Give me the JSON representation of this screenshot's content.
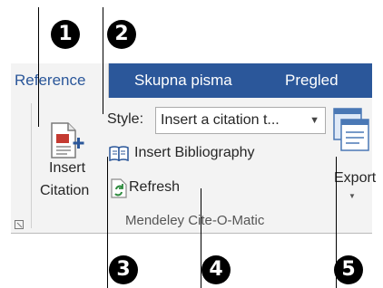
{
  "callouts": [
    "1",
    "2",
    "3",
    "4",
    "5"
  ],
  "tabs": {
    "active": "Reference",
    "items": [
      "Skupna pisma",
      "Pregled"
    ]
  },
  "insert_citation": {
    "line1": "Insert",
    "line2": "Citation"
  },
  "style": {
    "label": "Style:",
    "value": "Insert a citation t..."
  },
  "insert_bibliography_label": "Insert Bibliography",
  "refresh_label": "Refresh",
  "export_label": "Export",
  "group_label": "Mendeley Cite-O-Matic",
  "colors": {
    "ribbon_blue": "#2b579a",
    "ribbon_bg": "#f3f3f3"
  },
  "icons": [
    "insert-citation-icon",
    "book-icon",
    "refresh-icon",
    "export-icon",
    "dialog-launcher-icon"
  ]
}
